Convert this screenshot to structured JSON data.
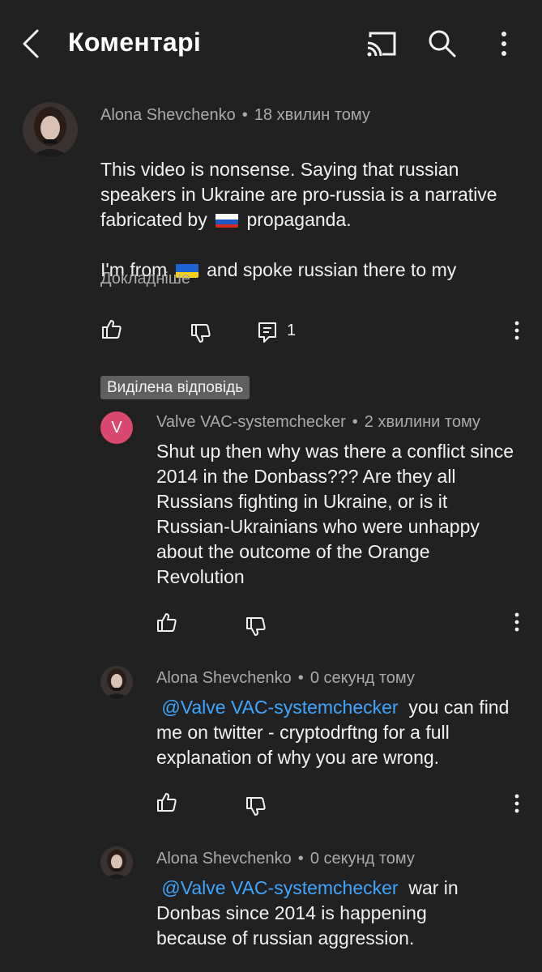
{
  "header": {
    "title": "Коментарі",
    "icons": [
      "back-chevron-icon",
      "cast-icon",
      "search-icon",
      "more-vert-icon"
    ]
  },
  "comments": [
    {
      "author": "Alona Shevchenko",
      "time": "18 хвилин тому",
      "text_part1": "This video is nonsense. Saying that russian speakers in Ukraine  are pro-russia is a narrative fabricated by",
      "flag1": "russia-flag",
      "text_part2": "propaganda.",
      "text_part3": "I'm from",
      "flag2": "ukraine-flag",
      "text_part4": "and spoke russian there to my",
      "read_more": "Докладніше",
      "reply_count": "1"
    }
  ],
  "highlighted_badge": "Виділена відповідь",
  "replies": [
    {
      "author": "Valve VAC-systemchecker",
      "avatar_letter": "V",
      "avatar_color": "#d9486e",
      "time": "2 хвилини тому",
      "text": "Shut up then why was there a conflict since 2014 in the Donbass??? Are they all Russians fighting in Ukraine, or is it Russian-Ukrainians who were unhappy about the outcome of the Orange Revolution"
    },
    {
      "author": "Alona Shevchenko",
      "time": "0 секунд тому",
      "mention": "@Valve VAC-systemchecker",
      "text": "you can find me on twitter - cryptodrftng for a full explanation of why you are wrong."
    },
    {
      "author": "Alona Shevchenko",
      "time": "0 секунд тому",
      "mention": "@Valve VAC-systemchecker",
      "text": "war in Donbas since 2014 is happening because of russian aggression."
    }
  ],
  "colors": {
    "background": "#212121",
    "text": "#f1f1f1",
    "secondary_text": "#aaaaaa",
    "mention": "#3ea6ff",
    "badge_bg": "#5f5f5f"
  }
}
